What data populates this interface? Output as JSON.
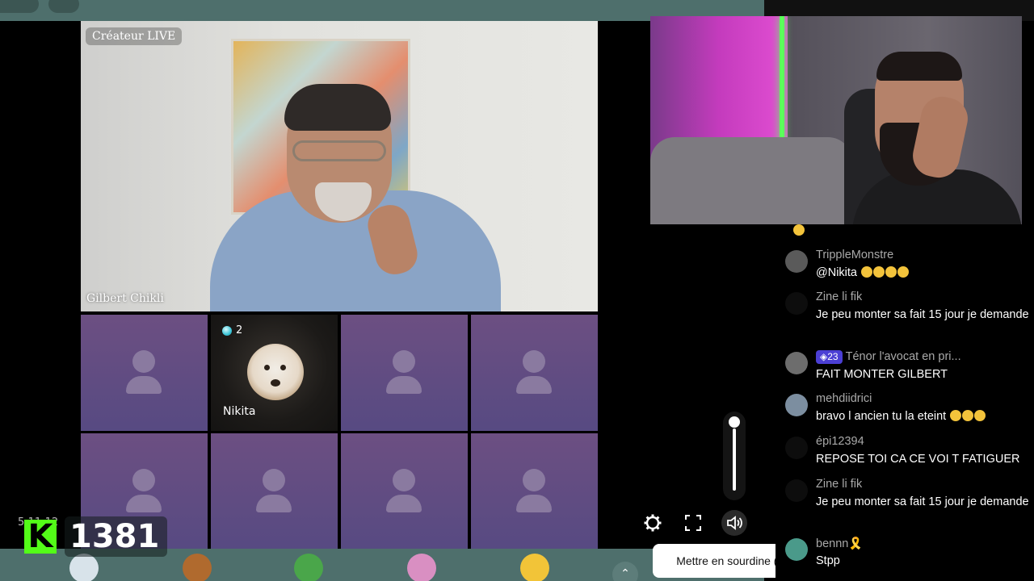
{
  "stream": {
    "main_tile_label": "Créateur LIVE",
    "main_tile_name": "Gilbert Chikli",
    "guest": {
      "name": "Nikita",
      "gem_count": "2"
    }
  },
  "overlay": {
    "timestamp": "5:11:12",
    "kick_logo": "K",
    "viewer_count": "1381"
  },
  "controls": {
    "mute_tooltip": "Mettre en sourdine (M)",
    "volume_level": 0.9,
    "icons": [
      "settings-icon",
      "fullscreen-icon",
      "volume-icon"
    ]
  },
  "chat": {
    "messages": [
      {
        "user": "TrippleMonstre",
        "text": "@Nikita",
        "emojis": 4,
        "avatar_color": "#5a5a5a"
      },
      {
        "user": "Zine li fik",
        "text": "Je peu monter sa fait 15 jour je demande",
        "emojis": 0,
        "avatar_color": "#0d0d0d"
      },
      {
        "user": "Ténor l'avocat en pri...",
        "badge": "23",
        "text": "FAIT MONTER GILBERT",
        "emojis": 0,
        "avatar_color": "#6d6d6d"
      },
      {
        "user": "mehdiidrici",
        "text": "bravo l ancien tu la eteint",
        "emojis": 3,
        "avatar_color": "#7c8ea0"
      },
      {
        "user": "épi12394",
        "text": "REPOSE TOI CA CE VOI T FATIGUER",
        "emojis": 0,
        "avatar_color": "#0d0d0d"
      },
      {
        "user": "Zine li fik",
        "text": "Je peu monter sa fait 15 jour je demande",
        "emojis": 0,
        "avatar_color": "#0d0d0d"
      },
      {
        "user": "bennn🎗️",
        "text": "Stpp",
        "emojis": 0,
        "avatar_color": "#4a9a8a"
      }
    ]
  },
  "colors": {
    "accent_teal": "#4e6f6c",
    "tile_purple": "#6c4f82",
    "kick_green": "#53fc18",
    "badge_purple": "#4b3fd4"
  }
}
